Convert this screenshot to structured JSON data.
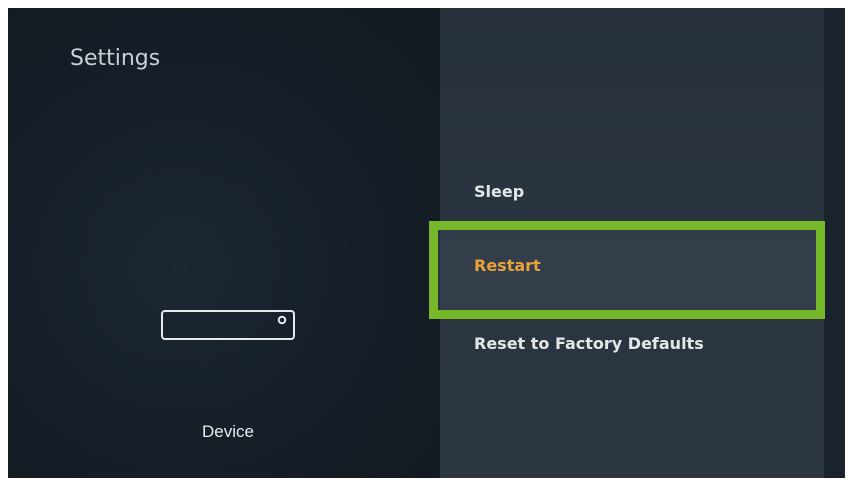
{
  "page": {
    "title": "Settings"
  },
  "device": {
    "label": "Device",
    "icon": "streaming-box-icon"
  },
  "menu": {
    "items": [
      {
        "label": "Sleep",
        "selected": false
      },
      {
        "label": "Restart",
        "selected": true
      },
      {
        "label": "Reset to Factory Defaults",
        "selected": false
      }
    ]
  },
  "colors": {
    "selected_text": "#e7a23b",
    "highlight_border": "#76b82a",
    "text": "#e4e7ea"
  }
}
